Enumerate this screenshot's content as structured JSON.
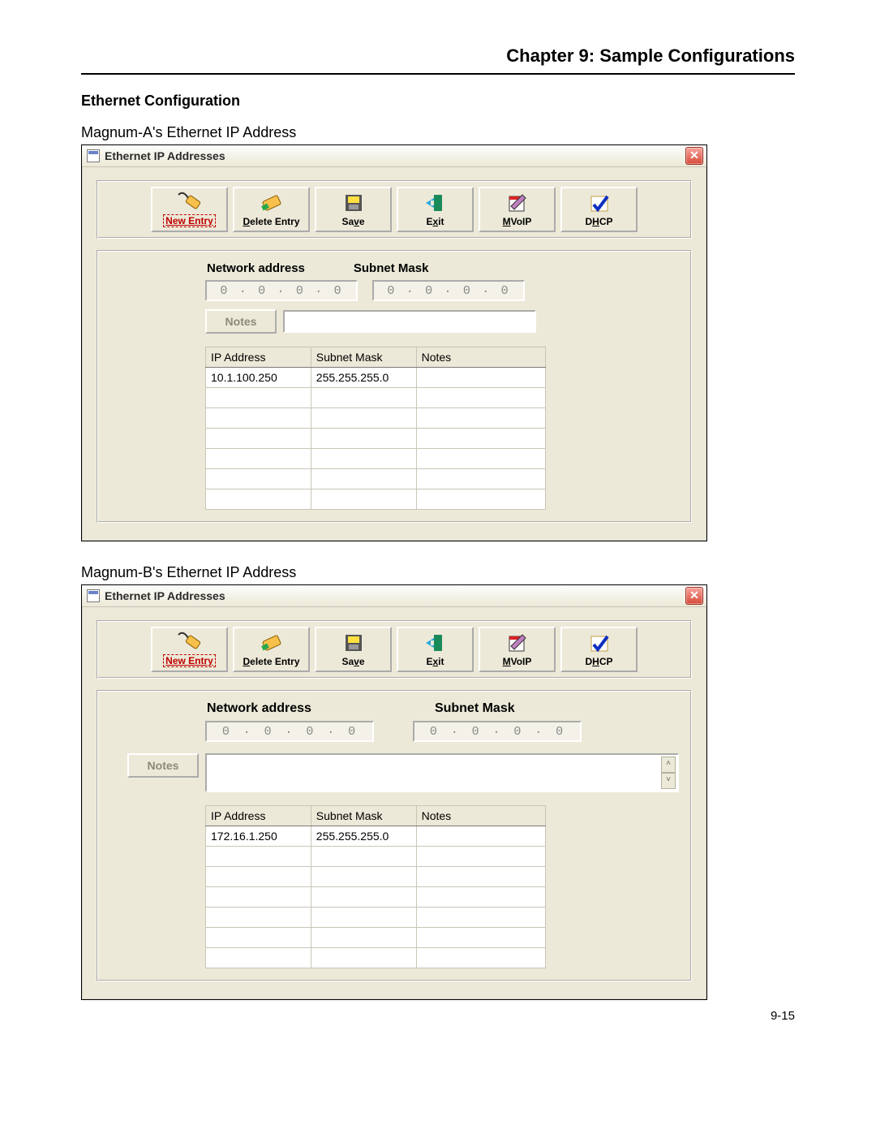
{
  "header": {
    "chapter": "Chapter 9: Sample Configurations"
  },
  "section": {
    "heading": "Ethernet Configuration"
  },
  "page_number": "9-15",
  "windows": [
    {
      "caption": "Magnum-A's Ethernet IP Address",
      "title": "Ethernet IP Addresses",
      "toolbar": {
        "new_entry": "New Entry",
        "delete_entry": "Delete Entry",
        "save": "Save",
        "exit": "Exit",
        "mvoip": "MVoIP",
        "dhcp": "DHCP"
      },
      "labels": {
        "network_address": "Network address",
        "subnet_mask": "Subnet Mask",
        "notes_btn": "Notes"
      },
      "net_addr": [
        "0",
        "0",
        "0",
        "0"
      ],
      "mask": [
        "0",
        "0",
        "0",
        "0"
      ],
      "table": {
        "headers": {
          "ip": "IP Address",
          "mask": "Subnet Mask",
          "notes": "Notes"
        },
        "rows": [
          {
            "ip": "10.1.100.250",
            "mask": "255.255.255.0",
            "notes": ""
          }
        ],
        "blank_rows": 6
      }
    },
    {
      "caption": "Magnum-B's Ethernet IP Address",
      "title": "Ethernet IP Addresses",
      "toolbar": {
        "new_entry": "New Entry",
        "delete_entry": "Delete Entry",
        "save": "Save",
        "exit": "Exit",
        "mvoip": "MVoIP",
        "dhcp": "DHCP"
      },
      "labels": {
        "network_address": "Network address",
        "subnet_mask": "Subnet Mask",
        "notes_btn": "Notes"
      },
      "net_addr": [
        "0",
        "0",
        "0",
        "0"
      ],
      "mask": [
        "0",
        "0",
        "0",
        "0"
      ],
      "table": {
        "headers": {
          "ip": "IP Address",
          "mask": "Subnet Mask",
          "notes": "Notes"
        },
        "rows": [
          {
            "ip": "172.16.1.250",
            "mask": "255.255.255.0",
            "notes": ""
          }
        ],
        "blank_rows": 6
      }
    }
  ]
}
